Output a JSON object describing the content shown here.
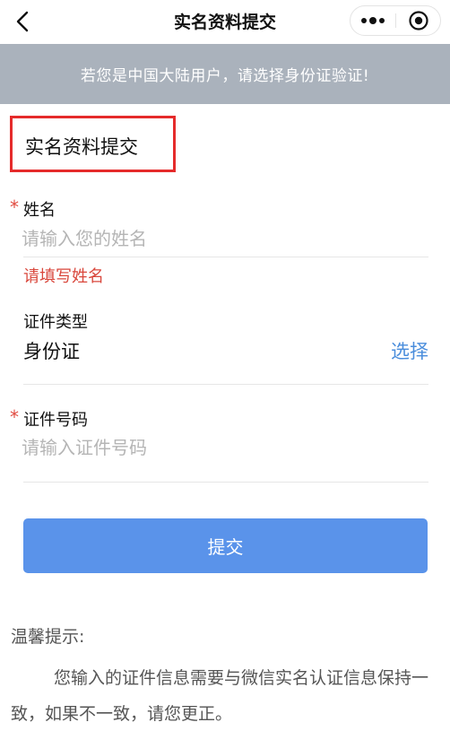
{
  "navbar": {
    "title": "实名资料提交"
  },
  "notice": {
    "text": "若您是中国大陆用户，请选择身份证验证!"
  },
  "section": {
    "title": "实名资料提交",
    "highlight_color": "#e52b2b"
  },
  "form": {
    "name": {
      "required_mark": "*",
      "label": "姓名",
      "placeholder": "请输入您的姓名",
      "error": "请填写姓名"
    },
    "id_type": {
      "label": "证件类型",
      "value": "身份证",
      "select_label": "选择"
    },
    "id_number": {
      "required_mark": "*",
      "label": "证件号码",
      "placeholder": "请输入证件号码"
    },
    "submit_label": "提交"
  },
  "tips": {
    "title": "温馨提示:",
    "body": "您输入的证件信息需要与微信实名认证信息保持一致，如果不一致，请您更正。"
  },
  "colors": {
    "notice_bg": "#aab2bc",
    "accent": "#5a93ea",
    "link": "#4a8ddc",
    "error": "#d9473c"
  },
  "icons": {
    "back": "back-chevron-icon",
    "more": "more-dots-icon",
    "close": "target-close-icon"
  }
}
